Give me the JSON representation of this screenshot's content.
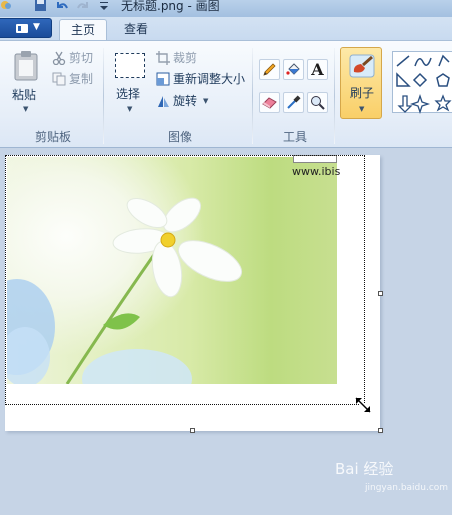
{
  "window": {
    "title": "无标题.png - 画图"
  },
  "tabs": [
    {
      "label": "主页",
      "active": true
    },
    {
      "label": "查看",
      "active": false
    }
  ],
  "clipboard": {
    "paste_label": "粘贴",
    "cut_label": "剪切",
    "copy_label": "复制",
    "group_label": "剪贴板"
  },
  "image": {
    "select_label": "选择",
    "crop_label": "裁剪",
    "resize_label": "重新调整大小",
    "rotate_label": "旋转",
    "group_label": "图像"
  },
  "tools": {
    "group_label": "工具",
    "items": [
      "pencil-icon",
      "fill-icon",
      "text-icon",
      "eraser-icon",
      "color-picker-icon",
      "magnifier-icon"
    ]
  },
  "brushes": {
    "label": "刷子"
  },
  "canvas": {
    "url_text": "www.ibis"
  },
  "watermark": {
    "text": "Bai 经验",
    "sub": "jingyan.baidu.com"
  },
  "colors": {
    "accent_highlight": "#f9cf68",
    "ribbon_bg": "#e6eef8",
    "workspace_bg": "#c6d4e6"
  }
}
